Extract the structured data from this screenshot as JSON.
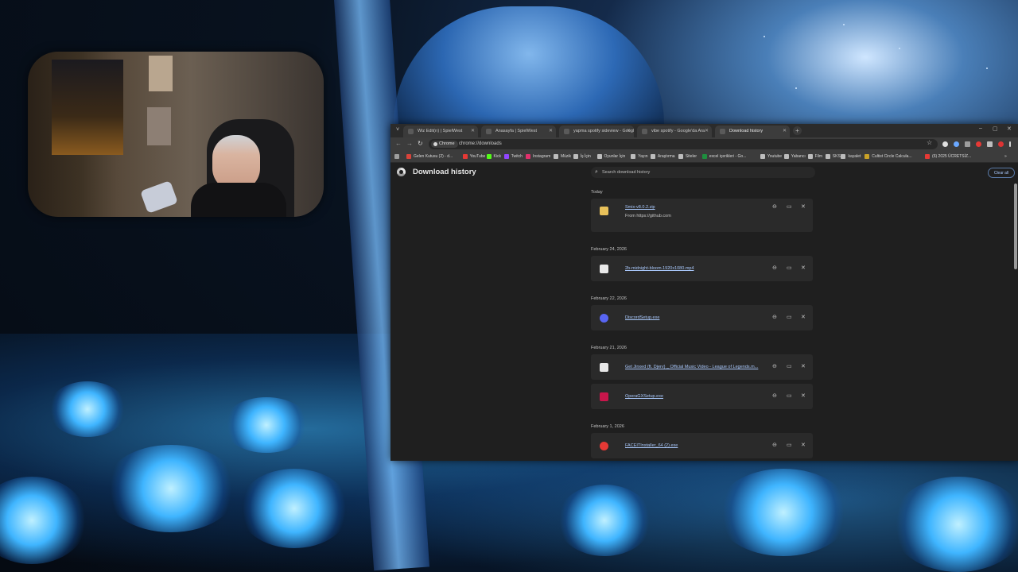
{
  "browser": {
    "tabs": [
      {
        "label": "Wiz Edit(rı) | SpielWest",
        "active": false
      },
      {
        "label": "Anasayfa | SpielWest",
        "active": false
      },
      {
        "label": "yapma spotify sideview - Google",
        "active": false
      },
      {
        "label": "vibe spotify - Google'da Ara",
        "active": false
      },
      {
        "label": "Download history",
        "active": true
      }
    ],
    "new_tab": "+",
    "menu_icon": "˅",
    "window_controls": {
      "minimize": "–",
      "maximize": "▢",
      "close": "✕"
    },
    "toolbar": {
      "back": "←",
      "forward": "→",
      "reload": "↻",
      "chip_label": "Chrome",
      "url": "chrome://downloads",
      "bookmark_star": "☆"
    },
    "bookmarks": [
      {
        "label": "Gelen Kutusu (2) - d...",
        "color": "#d9433a"
      },
      {
        "label": "YouTube",
        "color": "#e53935"
      },
      {
        "label": "Kick",
        "color": "#53fc18"
      },
      {
        "label": "Twitch",
        "color": "#9146ff"
      },
      {
        "label": "Instagram",
        "color": "#e1306c"
      },
      {
        "label": "Müzik",
        "color": "#bdbdbd"
      },
      {
        "label": "İş İçin",
        "color": "#bdbdbd"
      },
      {
        "label": "Oyunlar İçin",
        "color": "#bdbdbd"
      },
      {
        "label": "Yayın",
        "color": "#bdbdbd"
      },
      {
        "label": "Araştırma",
        "color": "#bdbdbd"
      },
      {
        "label": "Siteler",
        "color": "#bdbdbd"
      },
      {
        "label": "excel içerikleri - Go...",
        "color": "#1e8e3e"
      },
      {
        "label": "Youtube",
        "color": "#bdbdbd"
      },
      {
        "label": "Yabancı",
        "color": "#bdbdbd"
      },
      {
        "label": "Film",
        "color": "#bdbdbd"
      },
      {
        "label": "SKS",
        "color": "#bdbdbd"
      },
      {
        "label": "kayalet",
        "color": "#bdbdbd"
      },
      {
        "label": "Cultist Circle Calcula...",
        "color": "#c9a227"
      },
      {
        "label": "(6) 2025 ÜCRETSİZ...",
        "color": "#e53935"
      }
    ],
    "more_bookmarks": "»"
  },
  "downloads": {
    "title": "Download history",
    "search_placeholder": "Search download history",
    "clear_all": "Clear all",
    "groups": [
      {
        "date": "Today",
        "items": [
          {
            "name": "Smix-v8.0.2.zip",
            "from": "From https://github.com",
            "icon": "folder-zip-icon",
            "icon_color": "#e8c15a"
          }
        ]
      },
      {
        "date": "February 24, 2026",
        "items": [
          {
            "name": "2b-midnight-bloom.1920x1080.mp4",
            "from": "",
            "icon": "file-icon",
            "icon_color": "#e8e8e8"
          }
        ]
      },
      {
        "date": "February 22, 2026",
        "items": [
          {
            "name": "DiscordSetup.exe",
            "from": "",
            "icon": "discord-icon",
            "icon_color": "#5865f2"
          }
        ]
      },
      {
        "date": "February 21, 2026",
        "items": [
          {
            "name": "Get Jinxed (ft. Djerv) _ Official Music Video - League of Legends.m...",
            "from": "",
            "icon": "file-icon",
            "icon_color": "#e8e8e8"
          },
          {
            "name": "OperaGXSetup.exe",
            "from": "",
            "icon": "opera-gx-icon",
            "icon_color": "#c8164b"
          }
        ]
      },
      {
        "date": "February 1, 2026",
        "items": [
          {
            "name": "FACEITInstaller_64 (2).exe",
            "from": "",
            "icon": "faceit-icon",
            "icon_color": "#e53935"
          }
        ]
      }
    ],
    "action_icons": {
      "copy_link": "⊖",
      "show_in_folder": "▭",
      "remove": "✕"
    }
  }
}
